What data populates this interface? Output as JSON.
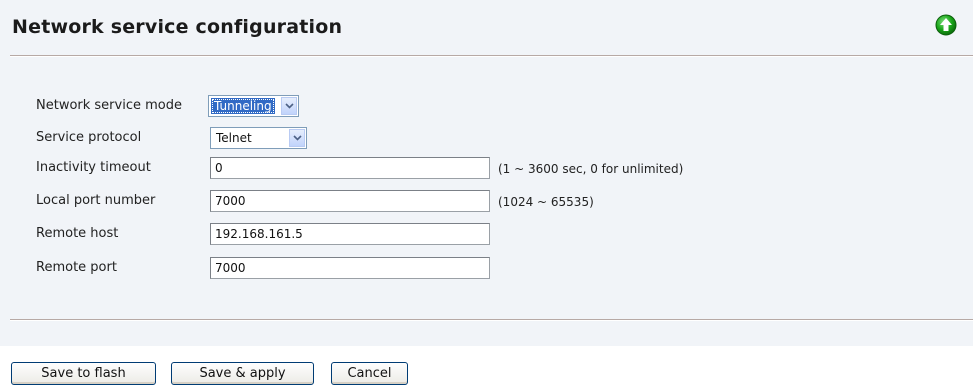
{
  "page": {
    "title": "Network service configuration"
  },
  "icons": {
    "up": "arrow-up-icon",
    "up_color": "#1aa61a"
  },
  "form": {
    "service_mode": {
      "label": "Network service mode",
      "value": "Tunneling"
    },
    "protocol": {
      "label": "Service protocol",
      "value": "Telnet"
    },
    "inactivity_timeout": {
      "label": "Inactivity timeout",
      "value": "0",
      "hint": "(1 ~ 3600 sec, 0 for unlimited)"
    },
    "local_port": {
      "label": "Local port number",
      "value": "7000",
      "hint": "(1024 ~ 65535)"
    },
    "remote_host": {
      "label": "Remote host",
      "value": "192.168.161.5"
    },
    "remote_port": {
      "label": "Remote port",
      "value": "7000"
    }
  },
  "buttons": {
    "save_flash": "Save to flash",
    "save_apply": "Save & apply",
    "cancel": "Cancel"
  }
}
